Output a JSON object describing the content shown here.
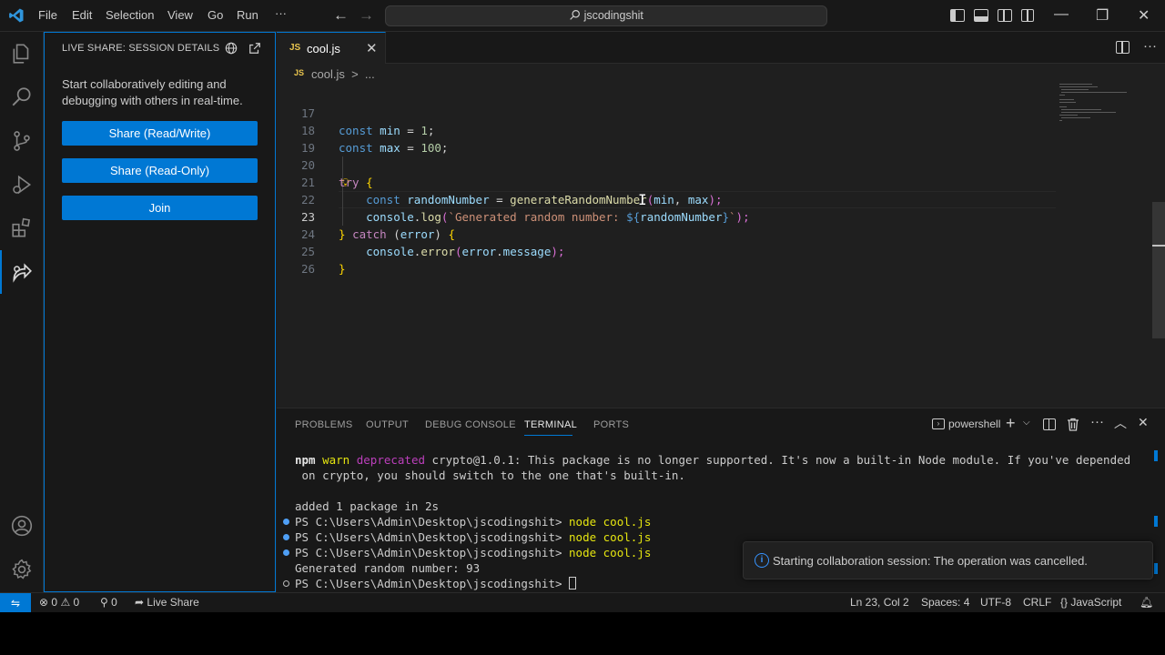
{
  "titlebar": {
    "menu": [
      "File",
      "Edit",
      "Selection",
      "View",
      "Go",
      "Run",
      "···"
    ],
    "search_text": "jscodingshit"
  },
  "sidebar": {
    "title": "LIVE SHARE: SESSION DETAILS",
    "description": "Start collaboratively editing and debugging with others in real-time.",
    "buttons": [
      "Share (Read/Write)",
      "Share (Read-Only)",
      "Join"
    ]
  },
  "editor": {
    "tab_icon": "JS",
    "tab_label": "cool.js",
    "breadcrumb_icon": "JS",
    "breadcrumb": "cool.js  >  ...",
    "line_numbers": [
      "17",
      "18",
      "19",
      "20",
      "21",
      "22",
      "23",
      "24",
      "25",
      "26"
    ],
    "lines": {
      "l17": [
        "const",
        " ",
        "min",
        " = ",
        "1",
        ";"
      ],
      "l18": [
        "const",
        " ",
        "max",
        " = ",
        "100",
        ";"
      ],
      "l20": [
        "try",
        " ",
        "{"
      ],
      "l21": [
        "const",
        " ",
        "randomNumber",
        " = ",
        "generateRandomNumber",
        "(",
        "min",
        ", ",
        "max",
        ");"
      ],
      "l22": [
        "console",
        ".",
        "log",
        "(",
        "`Generated random number: ",
        "${",
        "randomNumber",
        "}",
        "`",
        ");"
      ],
      "l23": [
        "}",
        " ",
        "catch",
        " (",
        "error",
        ") ",
        "{"
      ],
      "l24": [
        "console",
        ".",
        "error",
        "(",
        "error",
        ".",
        "message",
        ");"
      ],
      "l25": [
        "}"
      ]
    }
  },
  "panel": {
    "tabs": [
      "PROBLEMS",
      "OUTPUT",
      "DEBUG CONSOLE",
      "TERMINAL",
      "PORTS"
    ],
    "active_tab": "TERMINAL",
    "shell": "powershell",
    "terminal": {
      "warn_npm": "npm",
      "warn_word": "warn",
      "warn_dep": "deprecated",
      "warn_msg1": " crypto@1.0.1: This package is no longer supported. It's now a built-in Node module. If you've depended",
      "warn_msg2": " on crypto, you should switch to the one that's built-in.",
      "added": "added 1 package in 2s",
      "prompt": "PS C:\\Users\\Admin\\Desktop\\jscodingshit> ",
      "cmd": "node cool.js",
      "output": "Generated random number: 93"
    }
  },
  "notification": {
    "text": "Starting collaboration session: The operation was cancelled."
  },
  "statusbar": {
    "errors": "0",
    "warnings": "0",
    "ports": "0",
    "live_share": "Live Share",
    "position": "Ln 23, Col 2",
    "spaces": "Spaces: 4",
    "encoding": "UTF-8",
    "eol": "CRLF",
    "language": "JavaScript"
  },
  "colors": {
    "accent": "#0078d4",
    "background": "#1f1f1f",
    "sidebar": "#181818"
  }
}
